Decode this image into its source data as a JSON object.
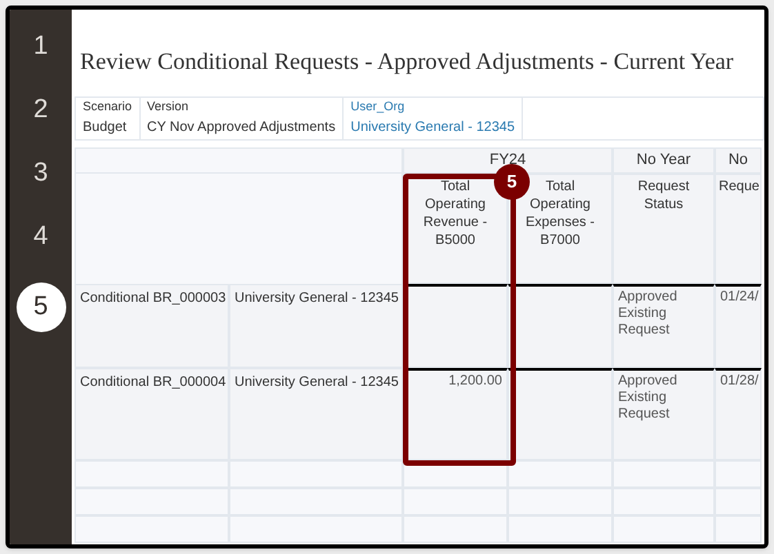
{
  "steps": [
    {
      "label": "1",
      "selected": false
    },
    {
      "label": "2",
      "selected": false
    },
    {
      "label": "3",
      "selected": false
    },
    {
      "label": "4",
      "selected": false
    },
    {
      "label": "5",
      "selected": true
    }
  ],
  "title": "Review Conditional Requests - Approved Adjustments - Current Year",
  "pov": [
    {
      "label": "Scenario",
      "value": "Budget",
      "kind": "plain"
    },
    {
      "label": "Version",
      "value": "CY Nov Approved Adjustments",
      "kind": "plain"
    },
    {
      "label": "User_Org",
      "value": "University General - 12345",
      "kind": "link"
    }
  ],
  "groups": [
    {
      "label": "FY24",
      "columns": [
        {
          "header": "Total Operating Revenue - B5000"
        },
        {
          "header": "Total Operating Expenses - B7000"
        }
      ]
    },
    {
      "label": "No Year",
      "columns": [
        {
          "header": "Request Status"
        }
      ]
    },
    {
      "label": "No",
      "columns": [
        {
          "header": "Reque"
        }
      ]
    }
  ],
  "rows": [
    {
      "name": "Conditional BR_000003",
      "org": "University General - 12345",
      "status": "Approved Existing Request",
      "request_date": "01/24/"
    },
    {
      "name": "Conditional BR_000004",
      "org": "University General - 12345",
      "revenue": "1,200.00",
      "status": "Approved Existing Request",
      "request_date": "01/28/"
    }
  ],
  "callout": {
    "label": "5"
  }
}
